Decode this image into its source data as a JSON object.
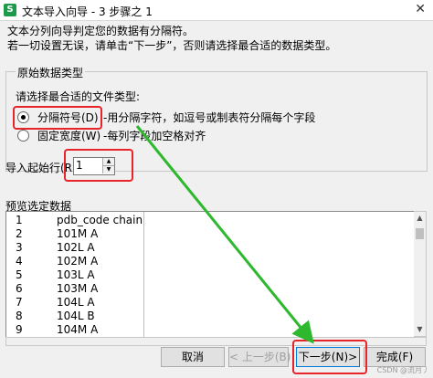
{
  "window": {
    "title": "文本导入向导 - 3 步骤之 1",
    "app_icon": "S",
    "close_glyph": "✕"
  },
  "description": {
    "line1": "文本分列向导判定您的数据有分隔符。",
    "line2": "若一切设置无误，请单击“下一步”，否则请选择最合适的数据类型。"
  },
  "original_type": {
    "group_title": "原始数据类型",
    "prompt": "请选择最合适的文件类型:",
    "options": [
      {
        "label": "分隔符号(D)",
        "desc": "-用分隔字符，如逗号或制表符分隔每个字段",
        "checked": true
      },
      {
        "label": "固定宽度(W)",
        "desc": "-每列字段加空格对齐",
        "checked": false
      }
    ]
  },
  "start_row": {
    "label": "导入起始行(R):",
    "value": "1"
  },
  "preview": {
    "label": "预览选定数据",
    "rows": [
      {
        "num": "1",
        "text": "pdb_code chain"
      },
      {
        "num": "2",
        "text": "101M A"
      },
      {
        "num": "3",
        "text": "102L A"
      },
      {
        "num": "4",
        "text": "102M A"
      },
      {
        "num": "5",
        "text": "103L A"
      },
      {
        "num": "6",
        "text": "103M A"
      },
      {
        "num": "7",
        "text": "104L A"
      },
      {
        "num": "8",
        "text": "104L B"
      },
      {
        "num": "9",
        "text": "104M A"
      }
    ]
  },
  "buttons": {
    "cancel": "取消",
    "back": "< 上一步(B)",
    "next": "下一步(N)>",
    "finish": "完成(F)"
  },
  "watermark": "CSDN @流月丿",
  "colors": {
    "highlight_box": "#e8242b",
    "arrow": "#2db82d"
  }
}
